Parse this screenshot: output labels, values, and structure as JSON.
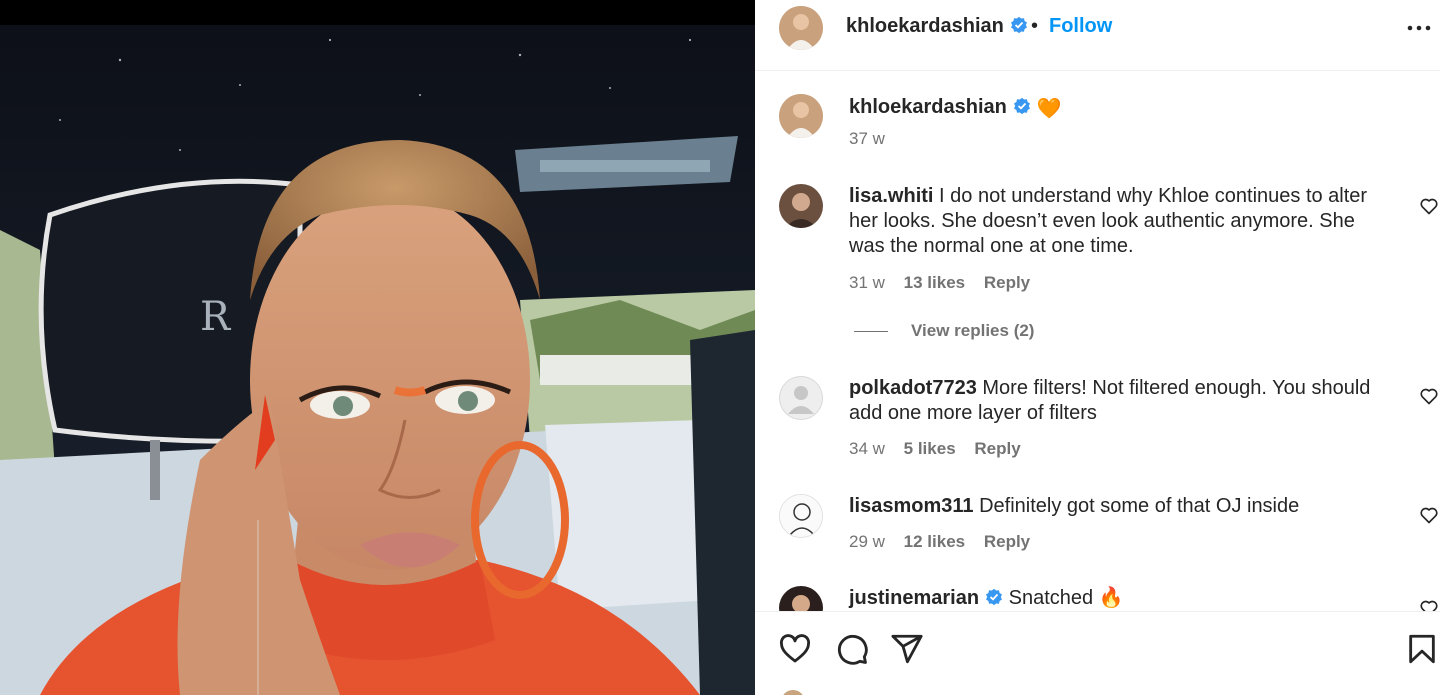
{
  "post": {
    "username": "khloekardashian",
    "follow_label": "Follow",
    "separator": "•"
  },
  "caption": {
    "username": "khloekardashian",
    "emoji": "🧡",
    "time": "37 w"
  },
  "comments": [
    {
      "username": "lisa.whiti",
      "text": "I do not understand why Khloe continues to alter her looks. She doesn’t even look authentic anymore. She was the normal one at one time.",
      "time": "31 w",
      "likes": "13 likes",
      "reply": "Reply"
    },
    {
      "username": "polkadot7723",
      "text": "More filters! Not filtered enough. You should add one more layer of filters",
      "time": "34 w",
      "likes": "5 likes",
      "reply": "Reply"
    },
    {
      "username": "lisasmom311",
      "text": "Definitely got some of that OJ inside",
      "time": "29 w",
      "likes": "12 likes",
      "reply": "Reply"
    },
    {
      "username": "justinemarian",
      "text": "Snatched 🔥"
    }
  ],
  "view_replies": "View replies (2)",
  "colors": {
    "accent": "#0095f6",
    "secondary_text": "#737373",
    "verified": "#3897f0"
  },
  "icons": [
    "verified-badge-icon",
    "more-options-icon",
    "heart-icon",
    "comment-icon",
    "share-icon",
    "save-bookmark-icon"
  ]
}
